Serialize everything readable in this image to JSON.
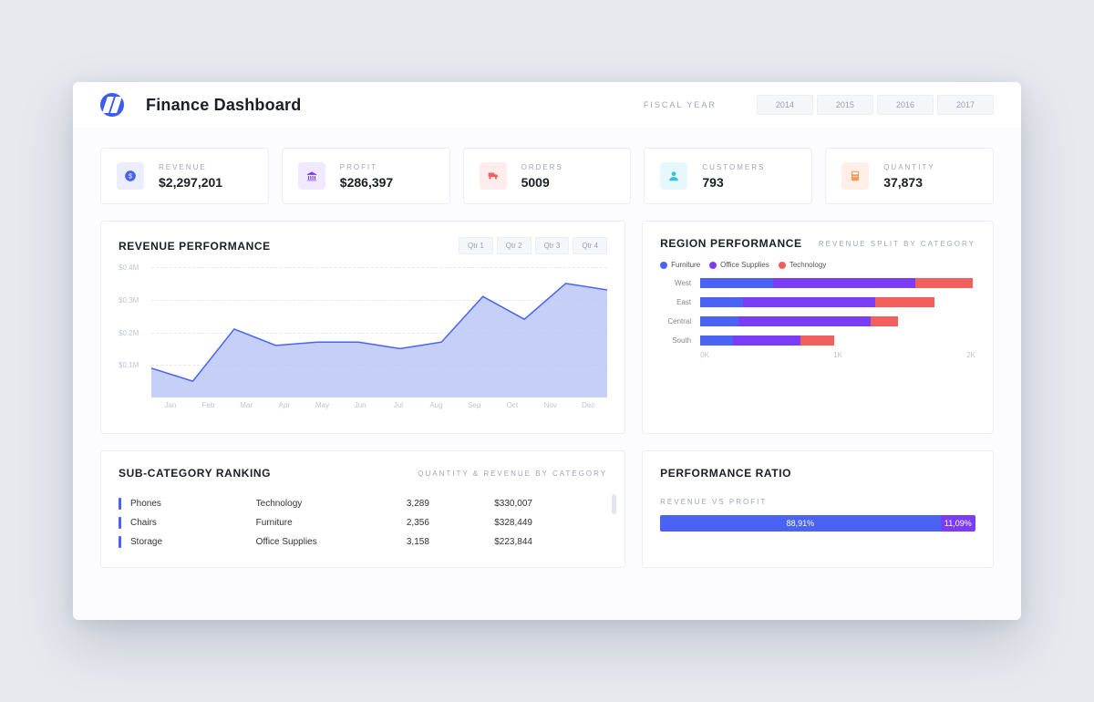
{
  "header": {
    "title": "Finance Dashboard",
    "fiscal_year_label": "FISCAL YEAR",
    "years": [
      "2014",
      "2015",
      "2016",
      "2017"
    ]
  },
  "kpis": [
    {
      "key": "revenue",
      "label": "REVENUE",
      "value": "$2,297,201",
      "icon": "dollar-icon",
      "bg": "#eaeeff",
      "fg": "#4a63f3"
    },
    {
      "key": "profit",
      "label": "PROFIT",
      "value": "$286,397",
      "icon": "bank-icon",
      "bg": "#efeaff",
      "fg": "#7a3df5"
    },
    {
      "key": "orders",
      "label": "ORDERS",
      "value": "5009",
      "icon": "truck-icon",
      "bg": "#ffecec",
      "fg": "#f1605d"
    },
    {
      "key": "customers",
      "label": "CUSTOMERS",
      "value": "793",
      "icon": "person-icon",
      "bg": "#e6f8fc",
      "fg": "#33c4d9"
    },
    {
      "key": "quantity",
      "label": "QUANTITY",
      "value": "37,873",
      "icon": "calc-icon",
      "bg": "#ffefe6",
      "fg": "#f19a5d"
    }
  ],
  "revenue_card": {
    "title": "REVENUE PERFORMANCE",
    "quarters": [
      "Qtr 1",
      "Qtr 2",
      "Qtr 3",
      "Qtr 4"
    ]
  },
  "region_card": {
    "title": "REGION PERFORMANCE",
    "subtitle": "REVENUE SPLIT BY CATEGORY",
    "legend": [
      {
        "name": "Furniture",
        "color": "#4a63f3"
      },
      {
        "name": "Office Supplies",
        "color": "#7a3df5"
      },
      {
        "name": "Technology",
        "color": "#f1605d"
      }
    ]
  },
  "subcat_card": {
    "title": "SUB-CATEGORY RANKING",
    "subtitle": "QUANTITY & REVENUE BY CATEGORY",
    "rows": [
      {
        "name": "Phones",
        "category": "Technology",
        "qty": "3,289",
        "rev": "$330,007"
      },
      {
        "name": "Chairs",
        "category": "Furniture",
        "qty": "2,356",
        "rev": "$328,449"
      },
      {
        "name": "Storage",
        "category": "Office Supplies",
        "qty": "3,158",
        "rev": "$223,844"
      }
    ]
  },
  "perf_card": {
    "title": "PERFORMANCE RATIO",
    "ratio_label": "REVENUE VS PROFIT",
    "segments": [
      {
        "label": "88,91%",
        "pct": 88.91,
        "color": "#4a63f3"
      },
      {
        "label": "11,09%",
        "pct": 11.09,
        "color": "#7a3df5"
      }
    ]
  },
  "chart_data": [
    {
      "id": "revenue_performance",
      "type": "area",
      "title": "REVENUE PERFORMANCE",
      "xlabel": "",
      "ylabel": "",
      "y_ticks": [
        "$0.1M",
        "$0.2M",
        "$0.3M",
        "$0.4M"
      ],
      "ylim_millions": [
        0,
        0.4
      ],
      "categories": [
        "Jan",
        "Feb",
        "Mar",
        "Apr",
        "May",
        "Jun",
        "Jul",
        "Aug",
        "Sep",
        "Oct",
        "Nov",
        "Dec"
      ],
      "values_millions": [
        0.09,
        0.05,
        0.21,
        0.16,
        0.17,
        0.17,
        0.15,
        0.17,
        0.31,
        0.24,
        0.35,
        0.33
      ]
    },
    {
      "id": "region_performance",
      "type": "bar",
      "orientation": "horizontal",
      "stacked": true,
      "title": "REGION PERFORMANCE",
      "x_ticks": [
        "0K",
        "1K",
        "2K"
      ],
      "xlim": [
        0,
        2000
      ],
      "categories": [
        "West",
        "East",
        "Central",
        "South"
      ],
      "series": [
        {
          "name": "Furniture",
          "color": "#4a63f3",
          "values": [
            530,
            310,
            280,
            240
          ]
        },
        {
          "name": "Office Supplies",
          "color": "#7a3df5",
          "values": [
            1030,
            960,
            960,
            490
          ]
        },
        {
          "name": "Technology",
          "color": "#f1605d",
          "values": [
            420,
            430,
            200,
            240
          ]
        }
      ]
    },
    {
      "id": "performance_ratio",
      "type": "bar",
      "orientation": "horizontal",
      "stacked": true,
      "title": "REVENUE VS PROFIT",
      "categories": [
        "ratio"
      ],
      "series": [
        {
          "name": "Revenue",
          "color": "#4a63f3",
          "values": [
            88.91
          ]
        },
        {
          "name": "Profit",
          "color": "#7a3df5",
          "values": [
            11.09
          ]
        }
      ]
    }
  ]
}
